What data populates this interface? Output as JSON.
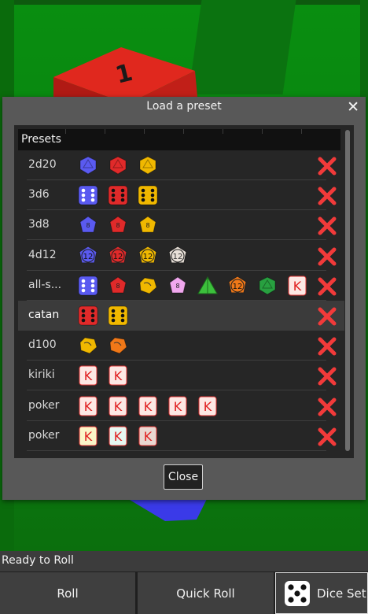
{
  "dialog": {
    "title": "Load a preset",
    "close_glyph": "✕",
    "list_header": "Presets",
    "close_button_label": "Close",
    "delete_icon": "red-x-icon",
    "selected_row": 5,
    "rows": [
      {
        "name": "2d20",
        "dice": [
          {
            "shape": "d20",
            "color": "#5a5af0"
          },
          {
            "shape": "d20",
            "color": "#e02a2a"
          },
          {
            "shape": "d20",
            "color": "#f0b800"
          }
        ]
      },
      {
        "name": "3d6",
        "dice": [
          {
            "shape": "d6",
            "color": "#5a5af0"
          },
          {
            "shape": "d6",
            "color": "#e02a2a"
          },
          {
            "shape": "d6",
            "color": "#f0b800"
          }
        ]
      },
      {
        "name": "3d8",
        "dice": [
          {
            "shape": "d8",
            "color": "#5a5af0"
          },
          {
            "shape": "d8",
            "color": "#e02a2a"
          },
          {
            "shape": "d8",
            "color": "#f0b800"
          }
        ]
      },
      {
        "name": "4d12",
        "dice": [
          {
            "shape": "d12",
            "color": "#5a5af0",
            "label": "12"
          },
          {
            "shape": "d12",
            "color": "#e02a2a",
            "label": "12"
          },
          {
            "shape": "d12",
            "color": "#f0b800",
            "label": "12"
          },
          {
            "shape": "d12",
            "color": "#e8e0d8",
            "label": "12"
          }
        ]
      },
      {
        "name": "all-s...",
        "dice": [
          {
            "shape": "d6",
            "color": "#5a5af0"
          },
          {
            "shape": "d8",
            "color": "#e02a2a"
          },
          {
            "shape": "d10",
            "color": "#f0b800"
          },
          {
            "shape": "d8",
            "color": "#f0a8ee"
          },
          {
            "shape": "d4",
            "color": "#3cc03c"
          },
          {
            "shape": "d12",
            "color": "#f07818",
            "label": "12"
          },
          {
            "shape": "d20",
            "color": "#28a040"
          },
          {
            "shape": "poker",
            "color": "#fde8e4",
            "label": "K"
          }
        ]
      },
      {
        "name": "catan",
        "dice": [
          {
            "shape": "d6",
            "color": "#e02a2a"
          },
          {
            "shape": "d6",
            "color": "#f0b800"
          }
        ]
      },
      {
        "name": "d100",
        "dice": [
          {
            "shape": "d10",
            "color": "#f0b800"
          },
          {
            "shape": "d10",
            "color": "#f07818"
          }
        ]
      },
      {
        "name": "kiriki",
        "dice": [
          {
            "shape": "poker",
            "color": "#fde8e4",
            "label": "K"
          },
          {
            "shape": "poker",
            "color": "#fde8e4",
            "label": "K"
          }
        ]
      },
      {
        "name": "poker",
        "dice": [
          {
            "shape": "poker",
            "color": "#fde8e4",
            "label": "K"
          },
          {
            "shape": "poker",
            "color": "#fde8e4",
            "label": "K"
          },
          {
            "shape": "poker",
            "color": "#fde8e4",
            "label": "K"
          },
          {
            "shape": "poker",
            "color": "#fde8e4",
            "label": "K"
          },
          {
            "shape": "poker",
            "color": "#fde8e4",
            "label": "K"
          }
        ]
      },
      {
        "name": "poker",
        "dice": [
          {
            "shape": "poker",
            "color": "#fbf6c8",
            "label": "K"
          },
          {
            "shape": "poker",
            "color": "#e6f8f2",
            "label": "K"
          },
          {
            "shape": "poker",
            "color": "#ead8d2",
            "label": "K"
          }
        ]
      }
    ]
  },
  "status": {
    "text": "Ready to Roll"
  },
  "toolbar": {
    "roll_label": "Roll",
    "quick_roll_label": "Quick Roll",
    "dice_set_label": "Dice Set",
    "dice_set_icon": "die-five-icon"
  },
  "scene": {
    "red_die_number": "1",
    "colors": {
      "table": "#098e10",
      "red_die": "#e0281e",
      "blue_die": "#3a3ae8"
    }
  }
}
